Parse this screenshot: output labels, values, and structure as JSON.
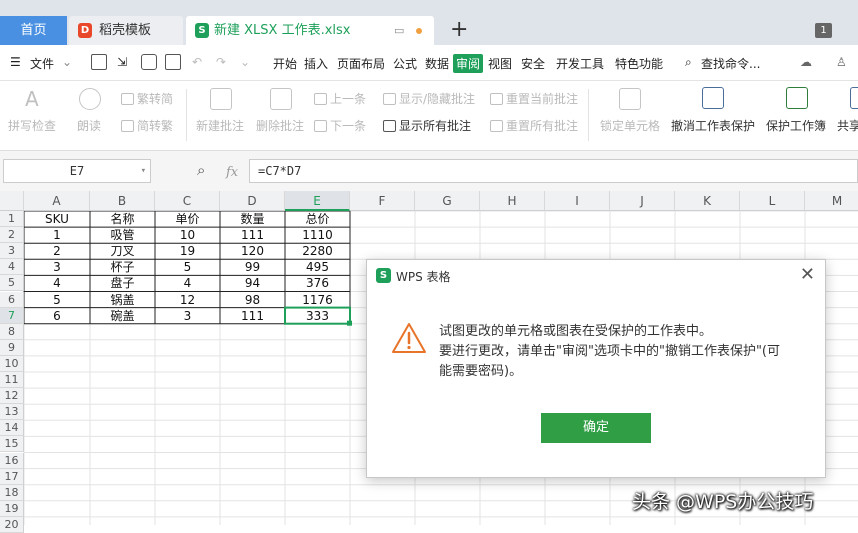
{
  "tabs": {
    "home": "首页",
    "template": "稻壳模板",
    "document": "新建 XLSX 工作表.xlsx",
    "new_tab": "+",
    "window_count": "1"
  },
  "menu": {
    "file": "文件",
    "items": [
      "开始",
      "插入",
      "页面布局",
      "公式",
      "数据",
      "审阅",
      "视图",
      "安全",
      "开发工具",
      "特色功能"
    ],
    "active": "审阅",
    "search": "查找命令..."
  },
  "ribbon": {
    "spell_check": "拼写检查",
    "read_aloud": "朗读",
    "trad_to_simp": "繁转简",
    "simp_to_trad": "简转繁",
    "new_comment": "新建批注",
    "delete_comment": "删除批注",
    "prev": "上一条",
    "next": "下一条",
    "show_hide_comments": "显示/隐藏批注",
    "show_all_comments": "显示所有批注",
    "reset_current_comment": "重置当前批注",
    "reset_all_comments": "重置所有批注",
    "lock_cell": "锁定单元格",
    "unprotect_sheet": "撤消工作表保护",
    "protect_workbook": "保护工作簿",
    "share": "共享"
  },
  "formula_bar": {
    "name_box": "E7",
    "fx": "fx",
    "formula": "=C7*D7"
  },
  "columns": [
    "A",
    "B",
    "C",
    "D",
    "E",
    "F",
    "G",
    "H",
    "I",
    "J",
    "K",
    "L",
    "M"
  ],
  "selected_column": "E",
  "selected_row": "7",
  "rows": [
    "1",
    "2",
    "3",
    "4",
    "5",
    "6",
    "7",
    "8",
    "9",
    "10",
    "11",
    "12",
    "13",
    "14",
    "15",
    "16",
    "17",
    "18",
    "19",
    "20"
  ],
  "table": {
    "headers": [
      "SKU",
      "名称",
      "单价",
      "数量",
      "总价"
    ],
    "rows": [
      [
        "1",
        "吸管",
        "10",
        "111",
        "1110"
      ],
      [
        "2",
        "刀叉",
        "19",
        "120",
        "2280"
      ],
      [
        "3",
        "杯子",
        "5",
        "99",
        "495"
      ],
      [
        "4",
        "盘子",
        "4",
        "94",
        "376"
      ],
      [
        "5",
        "锅盖",
        "12",
        "98",
        "1176"
      ],
      [
        "6",
        "碗盖",
        "3",
        "111",
        "333"
      ]
    ]
  },
  "dialog": {
    "title": "WPS 表格",
    "message": "试图更改的单元格或图表在受保护的工作表中。\n要进行更改，请单击\"审阅\"选项卡中的\"撤销工作表保护\"(可能需要密码)。",
    "ok": "确定"
  },
  "watermark": "头条 @WPS办公技巧",
  "colors": {
    "accent": "#1ea05a",
    "home_tab": "#4a90e2",
    "ok_button": "#2f9e45",
    "warning": "#e8742a"
  }
}
